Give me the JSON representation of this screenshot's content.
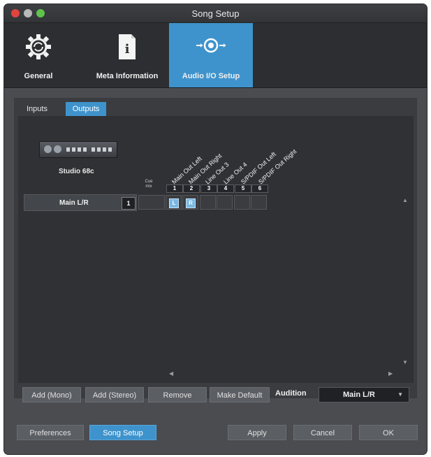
{
  "window": {
    "title": "Song Setup"
  },
  "toolbar": {
    "items": [
      {
        "label": "General",
        "icon": "gear-icon"
      },
      {
        "label": "Meta Information",
        "icon": "info-document-icon"
      },
      {
        "label": "Audio I/O Setup",
        "icon": "audio-io-icon"
      }
    ],
    "active_index": 2
  },
  "tabs": [
    {
      "label": "Inputs"
    },
    {
      "label": "Outputs"
    }
  ],
  "active_tab": "Outputs",
  "device": {
    "name": "Studio 68c"
  },
  "cue_mix_label": "Cue mix",
  "channels": [
    {
      "number": "1",
      "name": "Main Out Left"
    },
    {
      "number": "2",
      "name": "Main Out Right"
    },
    {
      "number": "3",
      "name": "Line Out 3"
    },
    {
      "number": "4",
      "name": "Line Out 4"
    },
    {
      "number": "5",
      "name": "S/PDIF Out Left"
    },
    {
      "number": "6",
      "name": "S/PDIF Out Right"
    }
  ],
  "rows": [
    {
      "name": "Main L/R",
      "count": "1",
      "marks": [
        "L",
        "R"
      ]
    }
  ],
  "actions": {
    "add_mono": "Add (Mono)",
    "add_stereo": "Add (Stereo)",
    "remove": "Remove",
    "make_default": "Make Default"
  },
  "audition": {
    "label": "Audition",
    "value": "Main L/R"
  },
  "footer": {
    "preferences": "Preferences",
    "song_setup": "Song Setup",
    "apply": "Apply",
    "cancel": "Cancel",
    "ok": "OK"
  },
  "colors": {
    "accent": "#3f93cc",
    "window_bg": "#4a4c50"
  }
}
